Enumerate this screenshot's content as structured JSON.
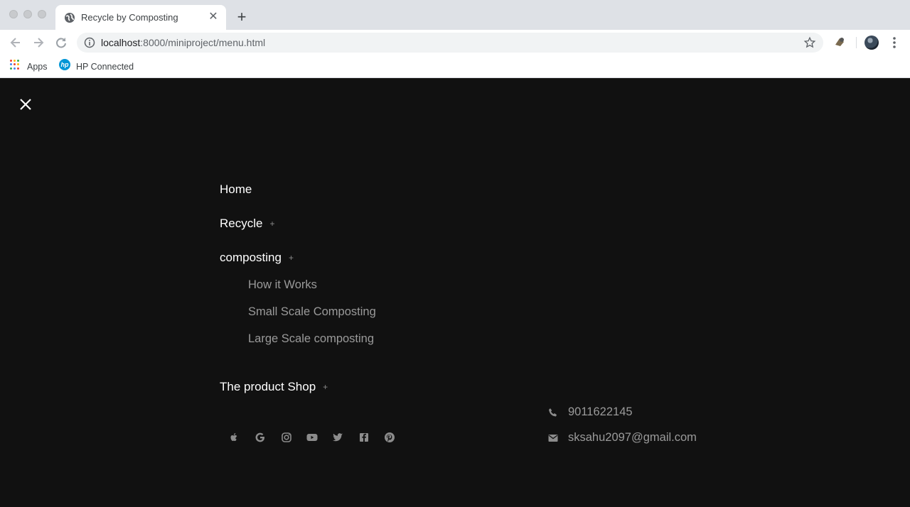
{
  "browser": {
    "tab_title": "Recycle by Composting",
    "url_host": "localhost",
    "url_rest": ":8000/miniproject/menu.html",
    "bookmarks": [
      {
        "label": "Apps",
        "icon": "apps-grid-icon"
      },
      {
        "label": "HP Connected",
        "icon": "hp-logo-icon"
      }
    ]
  },
  "menu": {
    "items": [
      {
        "label": "Home",
        "expandable": false
      },
      {
        "label": "Recycle",
        "expandable": true,
        "plus": "+"
      },
      {
        "label": "composting",
        "expandable": true,
        "plus": "+"
      },
      {
        "label": "The product Shop",
        "expandable": true,
        "plus": "+"
      }
    ],
    "composting_sub": [
      {
        "label": "How it Works"
      },
      {
        "label": "Small Scale Composting"
      },
      {
        "label": "Large Scale composting"
      }
    ]
  },
  "social": [
    "apple-icon",
    "google-icon",
    "instagram-icon",
    "youtube-icon",
    "twitter-icon",
    "facebook-icon",
    "pinterest-icon"
  ],
  "contact": {
    "phone": "9011622145",
    "email": "sksahu2097@gmail.com"
  },
  "colors": {
    "page_bg": "#111111",
    "menu_text": "#ffffff",
    "sub_text": "#9a9a9a"
  }
}
